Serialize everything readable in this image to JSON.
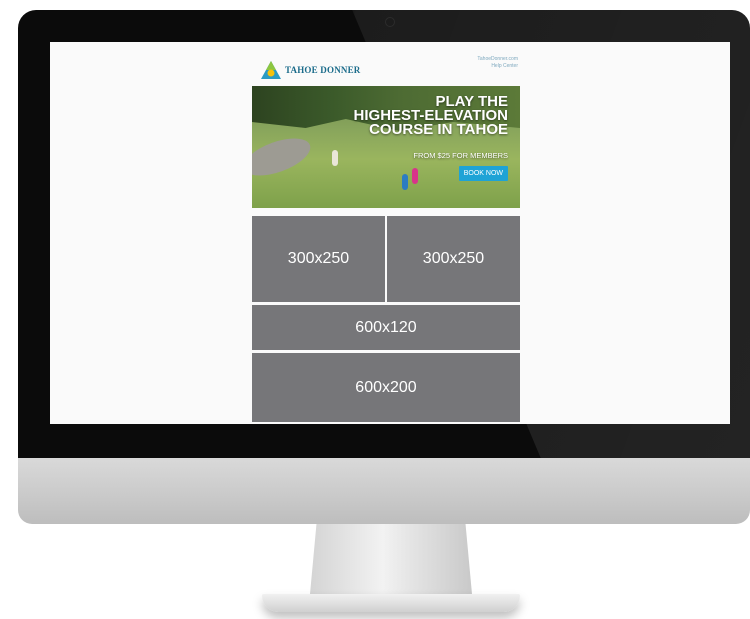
{
  "email": {
    "logo_text": "TAHOE DONNER",
    "header_links": [
      "TahoeDonner.com",
      "Help Center"
    ],
    "hero": {
      "headline_lines": [
        "PLAY THE",
        "HIGHEST-ELEVATION",
        "COURSE IN TAHOE"
      ],
      "subline": "FROM $25 FOR MEMBERS",
      "cta": "BOOK NOW"
    },
    "ads": [
      {
        "label": "300x250"
      },
      {
        "label": "300x250"
      },
      {
        "label": "600x120"
      },
      {
        "label": "600x200"
      }
    ]
  },
  "colors": {
    "ad_gray": "#767679",
    "cta_blue": "#1ea3d6",
    "brand_blue": "#1a6b8a"
  }
}
